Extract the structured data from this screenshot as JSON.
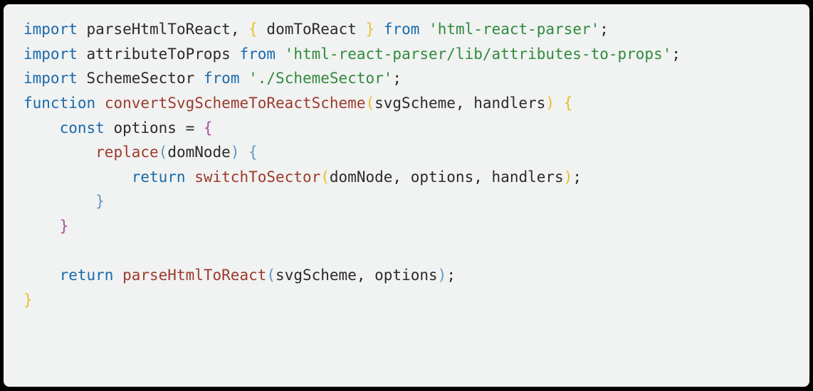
{
  "code": {
    "lines": [
      {
        "indent": 0,
        "tokens": [
          {
            "t": "import",
            "c": "tok-keyword"
          },
          {
            "t": " "
          },
          {
            "t": "parseHtmlToReact",
            "c": "tok-name"
          },
          {
            "t": ", "
          },
          {
            "t": "{",
            "c": "tok-brace-y"
          },
          {
            "t": " "
          },
          {
            "t": "domToReact",
            "c": "tok-name"
          },
          {
            "t": " "
          },
          {
            "t": "}",
            "c": "tok-brace-y"
          },
          {
            "t": " "
          },
          {
            "t": "from",
            "c": "tok-keyword"
          },
          {
            "t": " "
          },
          {
            "t": "'html-react-parser'",
            "c": "tok-string"
          },
          {
            "t": ";"
          }
        ]
      },
      {
        "indent": 0,
        "tokens": [
          {
            "t": "import",
            "c": "tok-keyword"
          },
          {
            "t": " "
          },
          {
            "t": "attributeToProps",
            "c": "tok-name"
          },
          {
            "t": " "
          },
          {
            "t": "from",
            "c": "tok-keyword"
          },
          {
            "t": " "
          },
          {
            "t": "'html-react-parser/lib/attributes-to-props'",
            "c": "tok-string"
          },
          {
            "t": ";"
          }
        ]
      },
      {
        "indent": 0,
        "tokens": [
          {
            "t": "import",
            "c": "tok-keyword"
          },
          {
            "t": " "
          },
          {
            "t": "SchemeSector",
            "c": "tok-name"
          },
          {
            "t": " "
          },
          {
            "t": "from",
            "c": "tok-keyword"
          },
          {
            "t": " "
          },
          {
            "t": "'./SchemeSector'",
            "c": "tok-string"
          },
          {
            "t": ";"
          }
        ]
      },
      {
        "indent": 0,
        "tokens": [
          {
            "t": ""
          }
        ]
      },
      {
        "indent": 0,
        "tokens": [
          {
            "t": "function",
            "c": "tok-keyword"
          },
          {
            "t": " "
          },
          {
            "t": "convertSvgSchemeToReactScheme",
            "c": "tok-fn"
          },
          {
            "t": "(",
            "c": "tok-paren-y"
          },
          {
            "t": "svgScheme",
            "c": "tok-name"
          },
          {
            "t": ", "
          },
          {
            "t": "handlers",
            "c": "tok-name"
          },
          {
            "t": ")",
            "c": "tok-paren-y"
          },
          {
            "t": " "
          },
          {
            "t": "{",
            "c": "tok-brace-y"
          }
        ]
      },
      {
        "indent": 1,
        "tokens": [
          {
            "t": "const",
            "c": "tok-keyword"
          },
          {
            "t": " "
          },
          {
            "t": "options",
            "c": "tok-name"
          },
          {
            "t": " = "
          },
          {
            "t": "{",
            "c": "tok-brace-p"
          }
        ]
      },
      {
        "indent": 2,
        "tokens": [
          {
            "t": "replace",
            "c": "tok-call"
          },
          {
            "t": "(",
            "c": "tok-paren-b"
          },
          {
            "t": "domNode",
            "c": "tok-name"
          },
          {
            "t": ")",
            "c": "tok-paren-b"
          },
          {
            "t": " "
          },
          {
            "t": "{",
            "c": "tok-brace-b"
          }
        ]
      },
      {
        "indent": 3,
        "tokens": [
          {
            "t": "return",
            "c": "tok-keyword"
          },
          {
            "t": " "
          },
          {
            "t": "switchToSector",
            "c": "tok-call"
          },
          {
            "t": "(",
            "c": "tok-paren-y"
          },
          {
            "t": "domNode",
            "c": "tok-name"
          },
          {
            "t": ", "
          },
          {
            "t": "options",
            "c": "tok-name"
          },
          {
            "t": ", "
          },
          {
            "t": "handlers",
            "c": "tok-name"
          },
          {
            "t": ")",
            "c": "tok-paren-y"
          },
          {
            "t": ";"
          }
        ]
      },
      {
        "indent": 2,
        "tokens": [
          {
            "t": "}",
            "c": "tok-brace-b"
          }
        ]
      },
      {
        "indent": 1,
        "tokens": [
          {
            "t": "}",
            "c": "tok-brace-p"
          }
        ]
      },
      {
        "indent": 1,
        "tokens": [
          {
            "t": ""
          }
        ]
      },
      {
        "indent": 1,
        "tokens": [
          {
            "t": "return",
            "c": "tok-keyword"
          },
          {
            "t": " "
          },
          {
            "t": "parseHtmlToReact",
            "c": "tok-call"
          },
          {
            "t": "(",
            "c": "tok-paren-b"
          },
          {
            "t": "svgScheme",
            "c": "tok-name"
          },
          {
            "t": ", "
          },
          {
            "t": "options",
            "c": "tok-name"
          },
          {
            "t": ")",
            "c": "tok-paren-b"
          },
          {
            "t": ";"
          }
        ]
      },
      {
        "indent": 0,
        "tokens": [
          {
            "t": "}",
            "c": "tok-brace-y"
          }
        ]
      }
    ],
    "indentWidth": 4
  }
}
